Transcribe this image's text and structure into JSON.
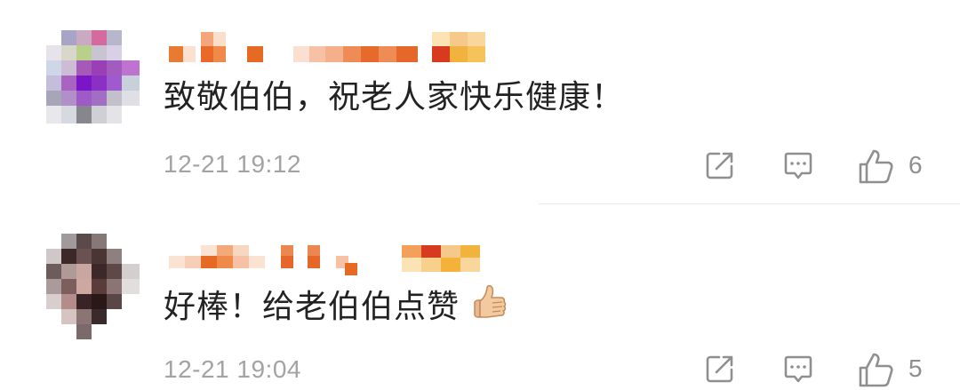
{
  "comments": [
    {
      "text": "致敬伯伯，祝老人家快乐健康！",
      "time": "12-21 19:12",
      "likes": "6",
      "has_thumb_emoji": false
    },
    {
      "text": "好棒！给老伯伯点赞",
      "time": "12-21 19:04",
      "likes": "5",
      "has_thumb_emoji": true
    }
  ],
  "icons": {
    "share": "share-icon",
    "reply": "reply-icon",
    "like": "like-icon",
    "emoji": "thumbs-up-emoji"
  },
  "colors": {
    "text": "#222222",
    "meta": "#a3a3a3",
    "icon": "#8f8f8f",
    "name_mosaic_1": "#e8742e",
    "name_mosaic_2": "#f2b24a"
  }
}
